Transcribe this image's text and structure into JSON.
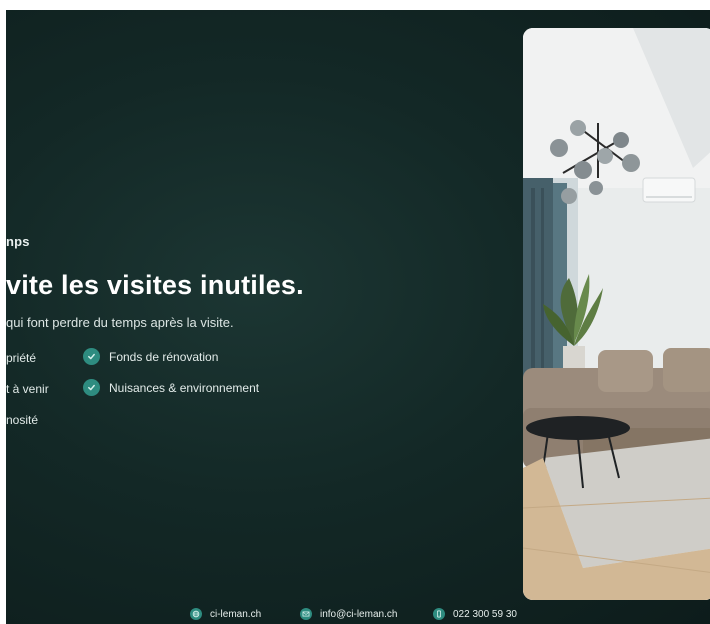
{
  "slide": {
    "kicker": "nps",
    "headline": "vite les visites inutiles.",
    "subline": "qui font perdre du temps après la visite.",
    "features_left": [
      "priété",
      "t à venir",
      "nosité"
    ],
    "features_right": [
      "Fonds de rénovation",
      "Nuisances & environnement"
    ]
  },
  "footer": {
    "website": "ci-leman.ch",
    "email": "info@ci-leman.ch",
    "phone": "022 300 59 30"
  },
  "colors": {
    "background": "#132826",
    "accent": "#2e8c80"
  },
  "icons": {
    "feature": "check-icon",
    "website": "globe-icon",
    "email": "mail-icon",
    "phone": "phone-icon"
  }
}
